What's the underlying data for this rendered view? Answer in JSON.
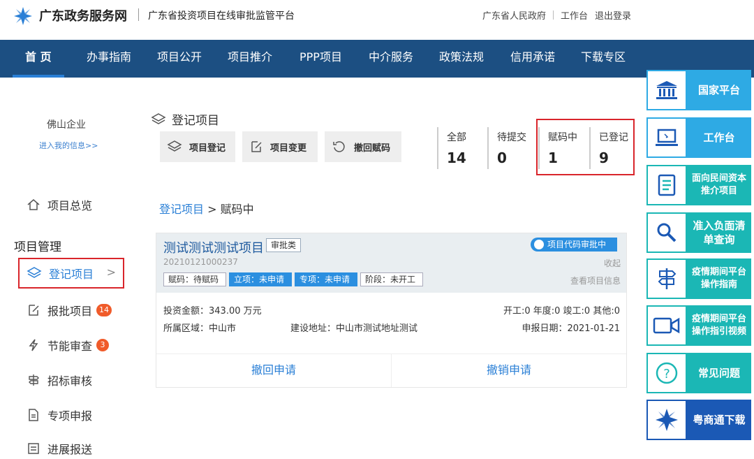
{
  "header": {
    "brand": "广东政务服务网",
    "platform": "广东省投资项目在线审批监管平台",
    "links": [
      "广东省人民政府",
      "工作台",
      "退出登录"
    ]
  },
  "nav": [
    "首 页",
    "办事指南",
    "项目公开",
    "项目推介",
    "PPP项目",
    "中介服务",
    "政策法规",
    "信用承诺",
    "下载专区"
  ],
  "sidebar": {
    "company": "佛山企业",
    "my_info": "进入我的信息>>",
    "overview": "项目总览",
    "section": "项目管理",
    "items": [
      {
        "label": "登记项目",
        "badge": ""
      },
      {
        "label": "报批项目",
        "badge": "14"
      },
      {
        "label": "节能审查",
        "badge": "3"
      },
      {
        "label": "招标审核",
        "badge": ""
      },
      {
        "label": "专项申报",
        "badge": ""
      },
      {
        "label": "进展报送",
        "badge": ""
      }
    ]
  },
  "main": {
    "title": "登记项目",
    "buttons": [
      "项目登记",
      "项目变更",
      "撤回赋码"
    ],
    "stats": [
      {
        "label": "全部",
        "value": "14"
      },
      {
        "label": "待提交",
        "value": "0"
      },
      {
        "label": "赋码中",
        "value": "1"
      },
      {
        "label": "已登记",
        "value": "9"
      }
    ],
    "breadcrumb_link": "登记项目",
    "breadcrumb_current": " > 赋码中"
  },
  "project": {
    "name": "测试测试测试项目",
    "category": "审批类",
    "status": "项目代码审批中",
    "code": "20210121000237",
    "collapse": "收起",
    "view_info": "查看项目信息",
    "chips": [
      "赋码：待赋码",
      "立项：未申请",
      "专项：未申请",
      "阶段：未开工"
    ],
    "investment": "投资金额：343.00 万元",
    "counts": "开工:0 年度:0 竣工:0 其他:0",
    "region": "所属区域：中山市",
    "address": "建设地址：中山市测试地址测试",
    "date": "申报日期：2021-01-21",
    "actions": [
      "撤回申请",
      "撤销申请"
    ]
  },
  "right_panel": [
    {
      "label": "国家平台",
      "icon": "government-building-icon"
    },
    {
      "label": "工作台",
      "icon": "laptop-icon"
    },
    {
      "label": "面向民间资本推介项目",
      "icon": "document-list-icon"
    },
    {
      "label": "准入负面清单查询",
      "icon": "search-icon"
    },
    {
      "label": "疫情期间平台操作指南",
      "icon": "signpost-icon"
    },
    {
      "label": "疫情期间平台操作指引视频",
      "icon": "video-camera-icon"
    },
    {
      "label": "常见问题",
      "icon": "question-icon"
    },
    {
      "label": "粤商通下载",
      "icon": "app-logo-icon"
    }
  ],
  "colors": {
    "nav_bg": "#1c4f82",
    "accent": "#2a7fd6",
    "highlight_border": "#d9252b",
    "panel_blue": "#2eaae4",
    "panel_green": "#1bb7b5",
    "panel_navy": "#1b59b5"
  }
}
